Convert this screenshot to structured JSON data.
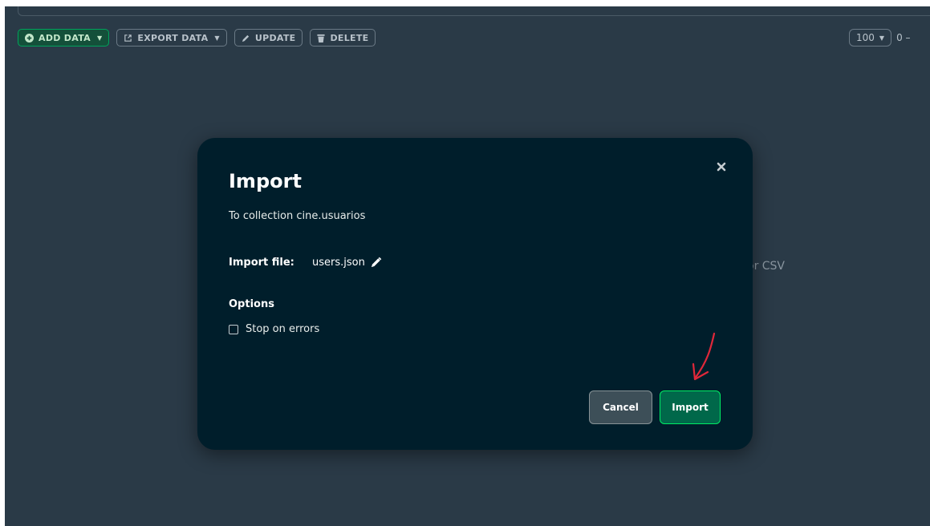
{
  "toolbar": {
    "add_data": "ADD DATA",
    "export_data": "EXPORT DATA",
    "update": "UPDATE",
    "delete": "DELETE"
  },
  "pager": {
    "page_size": "100",
    "range_fragment": "0 –"
  },
  "background_hint": "or CSV",
  "modal": {
    "title": "Import",
    "subtitle": "To collection cine.usuarios",
    "import_file_label": "Import file:",
    "file_name": "users.json",
    "options_label": "Options",
    "stop_on_errors_label": "Stop on errors",
    "stop_on_errors_checked": false,
    "cancel_label": "Cancel",
    "import_label": "Import"
  },
  "colors": {
    "background": "#2a3a47",
    "modal": "#001e2b",
    "primary_button": "#00684a",
    "primary_border": "#00ed64",
    "annotation": "#e0283a"
  },
  "icons": {
    "add": "plus-circle-icon",
    "export": "export-icon",
    "update": "pencil-icon",
    "delete": "trash-icon",
    "close": "close-icon",
    "edit_file": "pencil-icon"
  }
}
